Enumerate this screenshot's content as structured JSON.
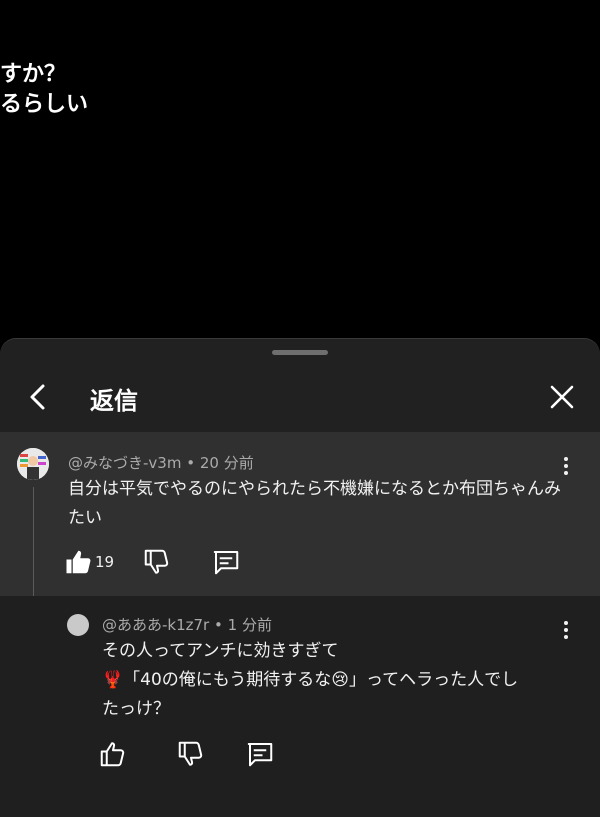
{
  "video": {
    "subtitle_line1": "すか？",
    "subtitle_line2": "るらしい"
  },
  "panel": {
    "title": "返信",
    "back_icon": "chevron-left-icon",
    "close_icon": "close-icon"
  },
  "parent_comment": {
    "author": "@みなづき-v3m",
    "time": "20 分前",
    "text": "自分は平気でやるのにやられたら不機嫌になるとか布団ちゃんみたい",
    "like_count": "19"
  },
  "reply_comment": {
    "author": "@あああ-k1z7r",
    "time": "1 分前",
    "text_line1": "その人ってアンチに効きすぎて",
    "text_line2_emoji": "🦞",
    "text_line2": "「40の俺にもう期待するな",
    "text_line2_emoji2": "😢",
    "text_line2_end": "」ってヘラった人でし",
    "text_line3": "たっけ？"
  },
  "separator": "•"
}
